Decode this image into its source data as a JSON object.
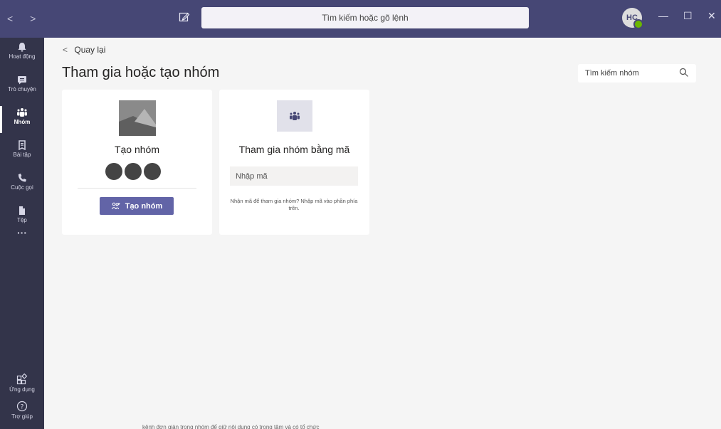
{
  "titlebar": {
    "search_placeholder": "Tìm kiếm hoặc gõ lệnh",
    "avatar_initials": "HC",
    "nav_back": "<",
    "nav_forward": ">",
    "minimize": "—",
    "maximize": "☐",
    "close": "✕"
  },
  "rail": {
    "items": [
      {
        "label": "Hoạt động",
        "icon": "bell-icon"
      },
      {
        "label": "Trò chuyện",
        "icon": "chat-icon"
      },
      {
        "label": "Nhóm",
        "icon": "teams-icon"
      },
      {
        "label": "Bài tập",
        "icon": "assignments-icon"
      },
      {
        "label": "Cuộc gọi",
        "icon": "phone-icon"
      },
      {
        "label": "Tệp",
        "icon": "file-icon"
      }
    ],
    "more": "···",
    "bottom_items": [
      {
        "label": "Ứng dụng",
        "icon": "apps-icon"
      },
      {
        "label": "Trợ giúp",
        "icon": "help-icon"
      }
    ]
  },
  "main": {
    "back_label": "Quay lại",
    "title": "Tham gia hoặc tạo nhóm",
    "team_search_placeholder": "Tìm kiếm nhóm",
    "create_card": {
      "title": "Tạo nhóm",
      "button_label": "Tạo nhóm"
    },
    "join_card": {
      "title": "Tham gia nhóm bằng mã",
      "input_placeholder": "Nhập mã",
      "hint": "Nhận mã để tham gia nhóm? Nhập mã vào phần phía trên."
    }
  },
  "background_text": "kênh đơn giản trong nhóm để giữ nội dung có trọng tâm và có tổ chức",
  "colors": {
    "titlebar": "#464775",
    "rail": "#33344a",
    "accent": "#6264a7",
    "presence": "#6bb700"
  }
}
